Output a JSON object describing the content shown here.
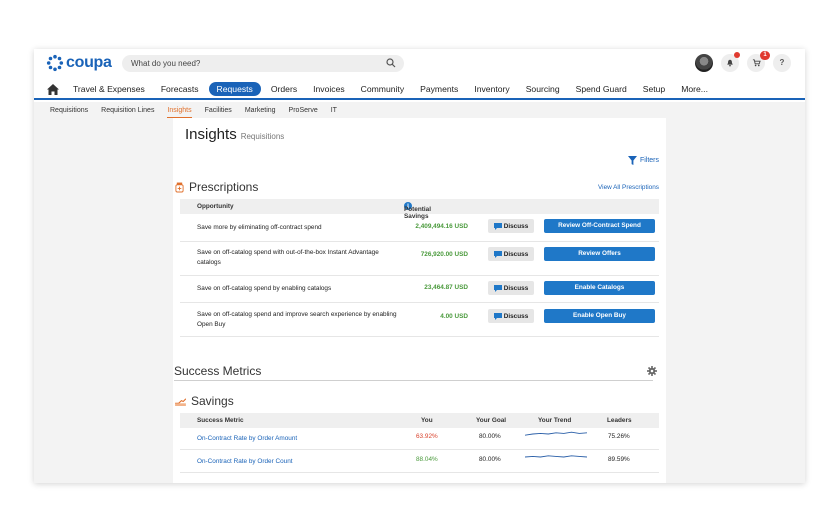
{
  "app": {
    "logo_text": "coupa",
    "search_placeholder": "What do you need?",
    "cart_badge": "1",
    "help_label": "?"
  },
  "main_nav": [
    {
      "label": "Travel & Expenses"
    },
    {
      "label": "Forecasts"
    },
    {
      "label": "Requests",
      "active": true
    },
    {
      "label": "Orders"
    },
    {
      "label": "Invoices"
    },
    {
      "label": "Community"
    },
    {
      "label": "Payments"
    },
    {
      "label": "Inventory"
    },
    {
      "label": "Sourcing"
    },
    {
      "label": "Spend Guard"
    },
    {
      "label": "Setup"
    },
    {
      "label": "More..."
    }
  ],
  "sub_nav": [
    {
      "label": "Requisitions"
    },
    {
      "label": "Requisition Lines"
    },
    {
      "label": "Insights",
      "active": true
    },
    {
      "label": "Facilities"
    },
    {
      "label": "Marketing"
    },
    {
      "label": "ProServe"
    },
    {
      "label": "IT"
    }
  ],
  "page": {
    "title": "Insights",
    "subtitle": "Requisitions",
    "filters_label": "Filters"
  },
  "prescriptions": {
    "title": "Prescriptions",
    "view_all": "View All Prescriptions",
    "col_opportunity": "Opportunity",
    "col_savings": "Potential Savings",
    "discuss_label": "Discuss",
    "rows": [
      {
        "desc": "Save more by eliminating off-contract spend",
        "amount": "2,409,494.16 USD",
        "action": "Review Off-Contract Spend"
      },
      {
        "desc": "Save on off-catalog spend with out-of-the-box Instant Advantage catalogs",
        "amount": "726,920.00 USD",
        "action": "Review Offers"
      },
      {
        "desc": "Save on off-catalog spend by enabling catalogs",
        "amount": "23,464.87 USD",
        "action": "Enable Catalogs"
      },
      {
        "desc": "Save on off-catalog spend and improve search experience by enabling Open Buy",
        "amount": "4.00 USD",
        "action": "Enable Open Buy"
      }
    ]
  },
  "success_metrics": {
    "title": "Success Metrics"
  },
  "savings": {
    "title": "Savings",
    "columns": [
      "Success Metric",
      "You",
      "Your Goal",
      "Your Trend",
      "Leaders"
    ],
    "rows": [
      {
        "metric": "On-Contract Rate by Order Amount",
        "you": "63.92%",
        "you_color": "#d9412b",
        "goal": "80.00%",
        "leaders": "75.26%",
        "trend": [
          0.6,
          0.5,
          0.45,
          0.5,
          0.4,
          0.45,
          0.35,
          0.45,
          0.4
        ]
      },
      {
        "metric": "On-Contract Rate by Order Count",
        "you": "88.04%",
        "you_color": "#4a9a3c",
        "goal": "80.00%",
        "leaders": "89.59%",
        "trend": [
          0.5,
          0.45,
          0.5,
          0.4,
          0.45,
          0.5,
          0.4,
          0.45,
          0.5
        ]
      }
    ]
  },
  "colors": {
    "brand": "#1a63b8",
    "button": "#1f78c8",
    "active_sub": "#e0702c",
    "positive": "#4a9a3c",
    "negative": "#d9412b"
  }
}
